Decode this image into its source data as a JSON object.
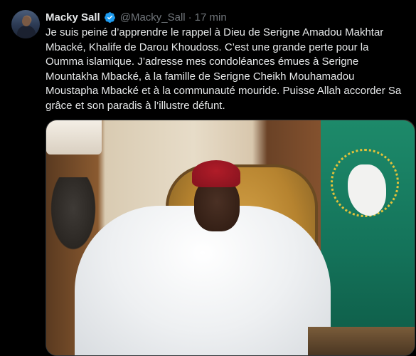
{
  "tweet": {
    "author_name": "Macky Sall",
    "handle": "@Macky_Sall",
    "separator": "·",
    "time": "17 min",
    "verified_color": "#1d9bf0",
    "text": "Je suis peiné d’apprendre le rappel à Dieu de Serigne Amadou Makhtar\nMbacké, Khalife de Darou Khoudoss. C’est une grande perte pour la\nOumma islamique. J’adresse mes condoléances émues à Serigne\nMountakha Mbacké, à la famille de Serigne Cheikh Mouhamadou\nMoustapha Mbacké et à la communauté mouride. Puisse Allah accorder Sa\ngrâce et son paradis à l’illustre défunt."
  },
  "colors": {
    "background": "#000000",
    "text_primary": "#e7e9ea",
    "text_secondary": "#71767b"
  }
}
